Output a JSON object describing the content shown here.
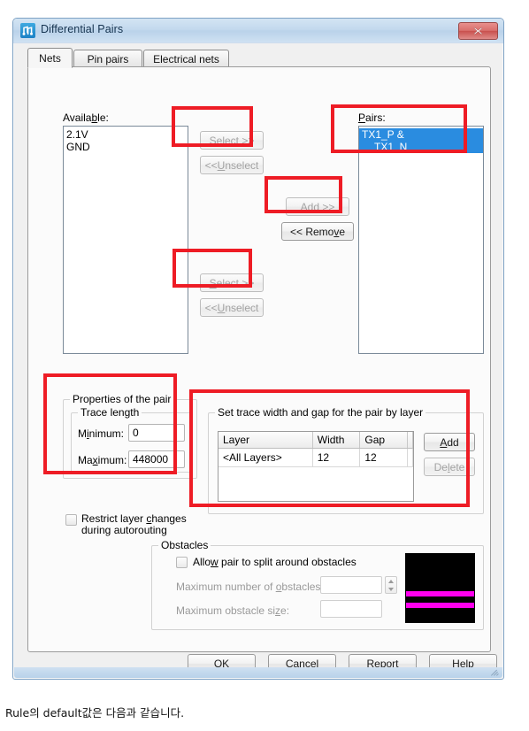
{
  "window": {
    "title": "Differential Pairs",
    "icon": "diff-pair-icon",
    "close_label": "✕"
  },
  "tabs": [
    {
      "label": "Nets",
      "active": true
    },
    {
      "label": "Pin pairs",
      "active": false
    },
    {
      "label": "Electrical nets",
      "active": false
    }
  ],
  "nets_tab": {
    "available": {
      "label": "Available:",
      "items": [
        "2.1V",
        "GND"
      ]
    },
    "pairs": {
      "label": "Pairs:",
      "items": [
        {
          "line1": "TX1_P &",
          "line2": "TX1_N",
          "selected": true
        }
      ]
    },
    "transfer_buttons": {
      "select_top": {
        "label": "Select >>",
        "enabled": false
      },
      "unselect_top": {
        "label": "<<Unselect",
        "enabled": false
      },
      "add": {
        "label": "Add >>",
        "enabled": false
      },
      "remove": {
        "label": "<< Remove",
        "enabled": true
      },
      "select_bottom": {
        "label": "Select >>",
        "enabled": false
      },
      "unselect_bottom": {
        "label": "<<Unselect",
        "enabled": false
      }
    },
    "properties": {
      "caption": "Properties of the pair",
      "trace_length": {
        "caption": "Trace length",
        "minimum_label": "Minimum:",
        "minimum_value": "0",
        "maximum_label": "Maximum:",
        "maximum_value": "448000"
      }
    },
    "restrict_layer": {
      "label_line1": "Restrict layer changes",
      "label_line2": "during autorouting",
      "checked": false
    },
    "trace_width": {
      "caption": "Set trace width and gap for the pair by layer",
      "columns": [
        "Layer",
        "Width",
        "Gap"
      ],
      "rows": [
        {
          "layer": "<All Layers>",
          "width": "12",
          "gap": "12"
        }
      ],
      "add_button": {
        "label": "Add",
        "enabled": true
      },
      "delete_button": {
        "label": "Delete",
        "enabled": false
      }
    },
    "obstacles": {
      "caption": "Obstacles",
      "allow_split_label": "Allow pair to split around obstacles",
      "allow_split_checked": false,
      "max_number_label": "Maximum number of obstacles:",
      "max_number_value": "",
      "max_size_label": "Maximum obstacle size:",
      "max_size_value": "",
      "preview": {
        "background": "#000000",
        "trace_color": "#ff00ee",
        "trace_count": 2
      }
    }
  },
  "footer_buttons": [
    {
      "label": "OK"
    },
    {
      "label": "Cancel"
    },
    {
      "label": "Report"
    },
    {
      "label": "Help"
    }
  ],
  "annotations": {
    "color": "#ee1c25",
    "boxes": [
      "select-top-button",
      "pairs-listbox",
      "add-button",
      "select-bottom-button",
      "properties-of-the-pair",
      "trace-width-table"
    ]
  },
  "page_caption": "Rule의 default값은 다음과 같습니다."
}
